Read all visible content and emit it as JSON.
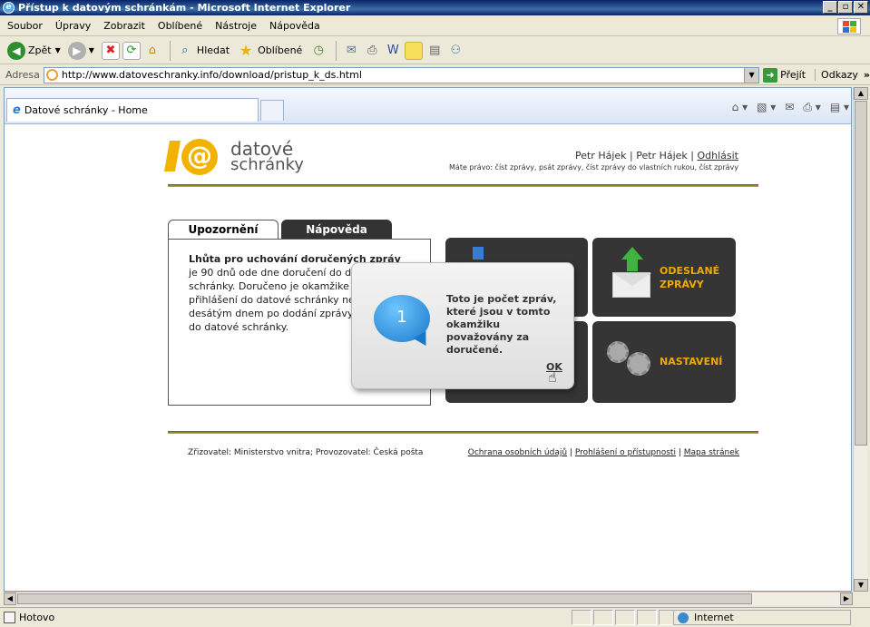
{
  "window": {
    "title": "Přístup k datovým schránkám - Microsoft Internet Explorer",
    "buttons": [
      "_",
      "▫",
      "✕"
    ]
  },
  "menu": [
    "Soubor",
    "Úpravy",
    "Zobrazit",
    "Oblíbené",
    "Nástroje",
    "Nápověda"
  ],
  "toolbar": {
    "back_label": "Zpět",
    "search_label": "Hledat",
    "favorites_label": "Oblíbené"
  },
  "address": {
    "label": "Adresa",
    "url": "http://www.datoveschranky.info/download/pristup_k_ds.html",
    "go_label": "Přejít",
    "links_label": "Odkazy"
  },
  "browser_tab": {
    "title": "Datové schránky - Home"
  },
  "page": {
    "logo_line1": "datové",
    "logo_line2": "schránky",
    "user": "Petr Hájek | Petr Hájek |",
    "logout": "Odhlásit",
    "rights": "Máte právo: číst zprávy, psát zprávy, číst zprávy do vlastních rukou, číst zprávy",
    "tab_notice": "Upozornění",
    "tab_help": "Nápověda",
    "notice_title": "Lhůta pro uchování doručených zpráv",
    "notice_lines": [
      "je 90 dnů ode dne doručení do da",
      "schránky. Doručeno je okamžike",
      "přihlášení do datové schránky ne",
      "desátým dnem po dodání zprávy",
      "do datové schránky."
    ],
    "tile_sent_line1": "ODESLANÉ",
    "tile_sent_line2": "ZPRÁVY",
    "tile_settings": "NASTAVENÍ",
    "footer_left": "Zřizovatel: Ministerstvo vnitra; Provozovatel: Česká pošta",
    "footer_links": [
      "Ochrana osobních údajů",
      "Prohlášení o přístupnosti",
      "Mapa stránek"
    ]
  },
  "popup": {
    "badge": "1",
    "text": "Toto je počet zpráv, které jsou v tomto okamžiku považovány za doručené.",
    "ok": "OK"
  },
  "status": {
    "text": "Hotovo",
    "zone": "Internet"
  }
}
